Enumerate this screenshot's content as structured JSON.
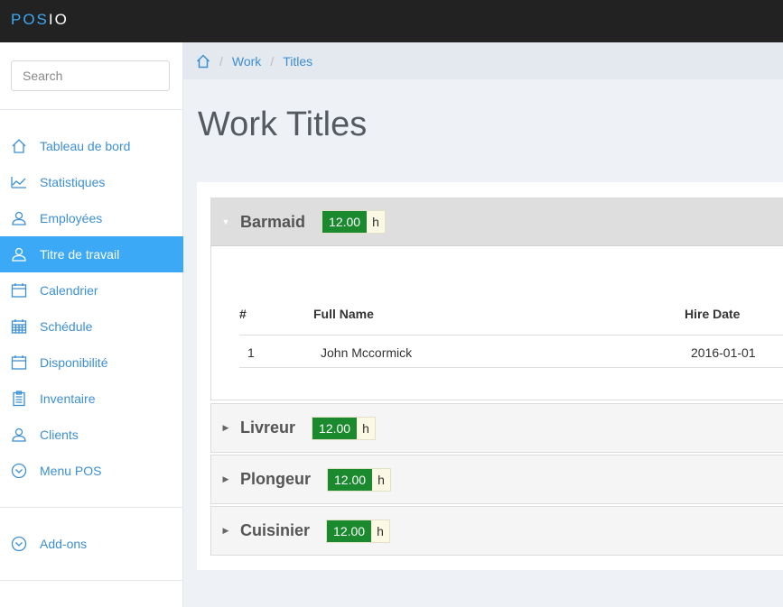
{
  "brand": {
    "part1": "POS",
    "part2": "IO"
  },
  "sidebar": {
    "search_placeholder": "Search",
    "items": [
      {
        "label": "Tableau de bord",
        "icon": "home-icon"
      },
      {
        "label": "Statistiques",
        "icon": "chart-line-icon"
      },
      {
        "label": "Employées",
        "icon": "user-icon"
      },
      {
        "label": "Titre de travail",
        "icon": "user-icon",
        "active": true
      },
      {
        "label": "Calendrier",
        "icon": "calendar-icon"
      },
      {
        "label": "Schédule",
        "icon": "calendar-grid-icon"
      },
      {
        "label": "Disponibilité",
        "icon": "calendar-icon"
      },
      {
        "label": "Inventaire",
        "icon": "clipboard-icon"
      },
      {
        "label": "Clients",
        "icon": "user-icon"
      },
      {
        "label": "Menu POS",
        "icon": "chevron-circle-icon"
      }
    ],
    "addons": {
      "label": "Add-ons",
      "icon": "chevron-circle-icon"
    }
  },
  "breadcrumb": {
    "home_icon": "home-icon",
    "items": [
      "Work",
      "Titles"
    ]
  },
  "page": {
    "title": "Work Titles"
  },
  "titles": [
    {
      "name": "Barmaid",
      "rate": "12.00",
      "unit": "h",
      "expanded": true,
      "table": {
        "columns": [
          "#",
          "Full Name",
          "Hire Date"
        ],
        "rows": [
          {
            "num": "1",
            "name": "John Mccormick",
            "hire_date": "2016-01-01"
          }
        ]
      }
    },
    {
      "name": "Livreur",
      "rate": "12.00",
      "unit": "h",
      "expanded": false
    },
    {
      "name": "Plongeur",
      "rate": "12.00",
      "unit": "h",
      "expanded": false
    },
    {
      "name": "Cuisinier",
      "rate": "12.00",
      "unit": "h",
      "expanded": false
    }
  ],
  "colors": {
    "accent": "#3ba9f5",
    "topbar": "#222222",
    "rate_badge": "#1b8a2f",
    "link": "#3c8fd2"
  }
}
